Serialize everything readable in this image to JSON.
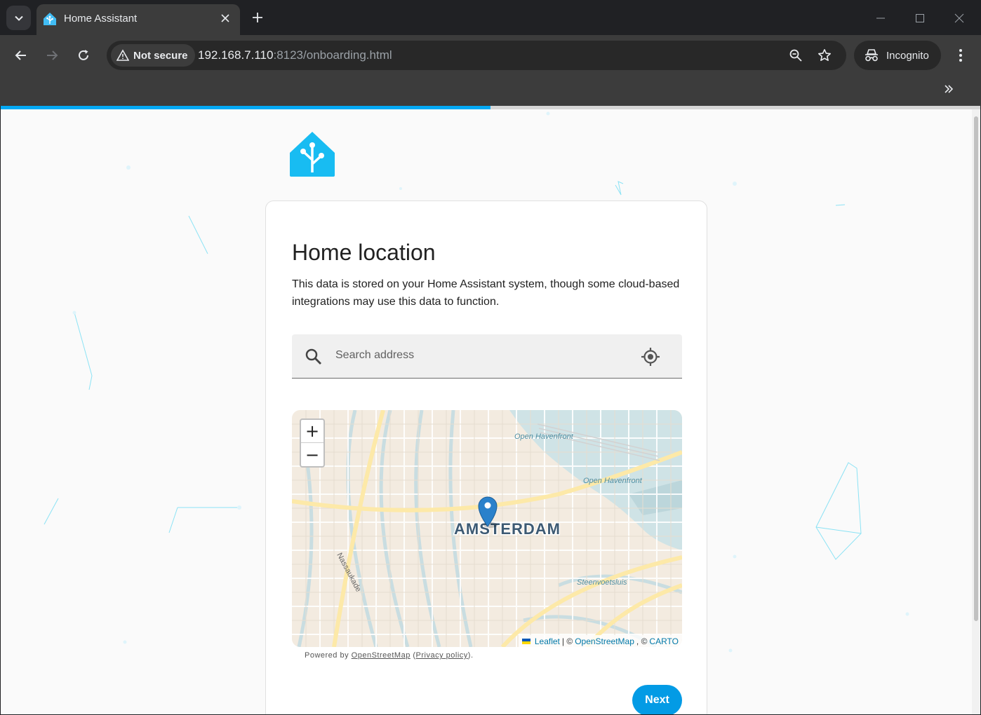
{
  "browser": {
    "tab": {
      "title": "Home Assistant",
      "favicon": "home-assistant-icon"
    },
    "address_bar": {
      "security_label": "Not secure",
      "url_host": "192.168.7.110",
      "url_rest": ":8123/onboarding.html"
    },
    "profile_label": "Incognito",
    "icons": [
      "tab-search-icon",
      "close-icon",
      "plus-icon",
      "minimize-icon",
      "maximize-icon",
      "window-close-icon",
      "back-arrow-icon",
      "forward-arrow-icon",
      "reload-icon",
      "warning-icon",
      "zoom-icon",
      "star-icon",
      "incognito-icon",
      "more-vert-icon",
      "chevron-double-right-icon"
    ]
  },
  "onboarding": {
    "progress": 0.5,
    "accent_color": "#03a9f4",
    "card": {
      "title": "Home location",
      "description": "This data is stored on your Home Assistant system, though some cloud-based integrations may use this data to function."
    },
    "search": {
      "placeholder": "Search address",
      "value": ""
    },
    "map": {
      "zoom_in_label": "+",
      "zoom_out_label": "−",
      "city_label": "AMSTERDAM",
      "street_labels": [
        "Open Havenfront",
        "Open Havenfront",
        "Nassaukade",
        "Steenvoetsluis"
      ],
      "attribution": {
        "leaflet": "Leaflet",
        "separator": "| ©",
        "osm": "OpenStreetMap",
        "separator2": ", ©",
        "carto": "CARTO"
      }
    },
    "powered_by": {
      "prefix": "Powered by",
      "link": "OpenStreetMap",
      "open_paren": " (",
      "privacy": "Privacy policy",
      "close_paren": ")."
    },
    "next_label": "Next"
  }
}
